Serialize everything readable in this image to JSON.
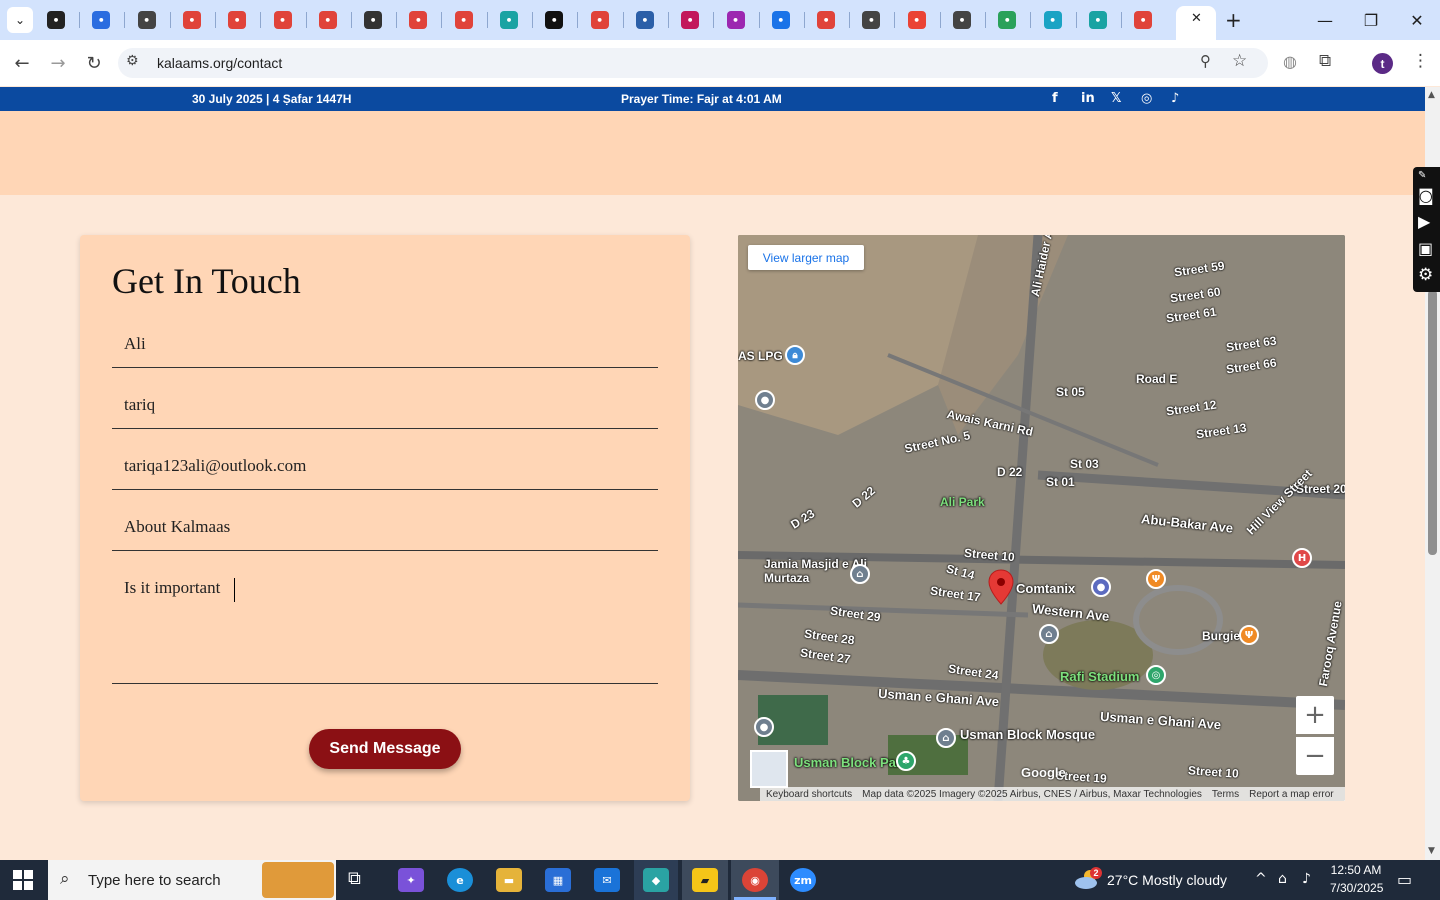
{
  "browser": {
    "url": "kalaams.org/contact",
    "close_tab_glyph": "✕",
    "new_tab_glyph": "+",
    "profile_initial": "t"
  },
  "topbar": {
    "date_text": "30 July 2025 | 4 Ṣafar 1447H",
    "prayer_prefix": "Prayer Time: ",
    "prayer_name": "Fajr",
    "prayer_suffix": " at 4:01 AM",
    "social_icons": [
      "facebook-icon",
      "linkedin-icon",
      "x-icon",
      "instagram-icon",
      "tiktok-icon"
    ]
  },
  "form": {
    "title": "Get In Touch",
    "first_name": "Ali",
    "last_name": "tariq",
    "email": "tariqa123ali@outlook.com",
    "subject": "About Kalmaas",
    "message": "Is it important",
    "submit_label": "Send Message"
  },
  "map": {
    "view_larger_label": "View larger map",
    "zoom_in": "+",
    "zoom_out": "−",
    "google_mark": "Google",
    "attribution": {
      "shortcuts": "Keyboard shortcuts",
      "data": "Map data ©2025 Imagery ©2025 Airbus, CNES / Airbus, Maxar Technologies",
      "terms": "Terms",
      "report": "Report a map error"
    },
    "labels": [
      "AS LPG",
      "Awais Karni Rd",
      "Street No. 5",
      "D 22",
      "D 23",
      "Ali Park",
      "Jamia Masjid e Ali Murtaza",
      "Street 29",
      "Street 28",
      "Street 27",
      "Street 17",
      "Street 10",
      "St 14",
      "Comtanix",
      "Western Ave",
      "Abu-Bakar Ave",
      "Rafi Stadium",
      "Burgie's",
      "Usman e Ghani Ave",
      "Usman Block Mosque",
      "Usman Block Park",
      "Street 24",
      "Street 59",
      "Street 60",
      "Street 61",
      "Street 63",
      "Street 66",
      "Road E",
      "Street 12",
      "Street 13",
      "St 05",
      "St 03",
      "St 01",
      "Ali Haider Ave",
      "Street 20",
      "Street 19",
      "Street 10",
      "Hill View Street",
      "Farooq Avenue"
    ]
  },
  "taskbar": {
    "search_placeholder": "Type here to search",
    "weather": "27°C  Mostly cloudy",
    "weather_badge": "2",
    "time": "12:50 AM",
    "date": "7/30/2025"
  }
}
